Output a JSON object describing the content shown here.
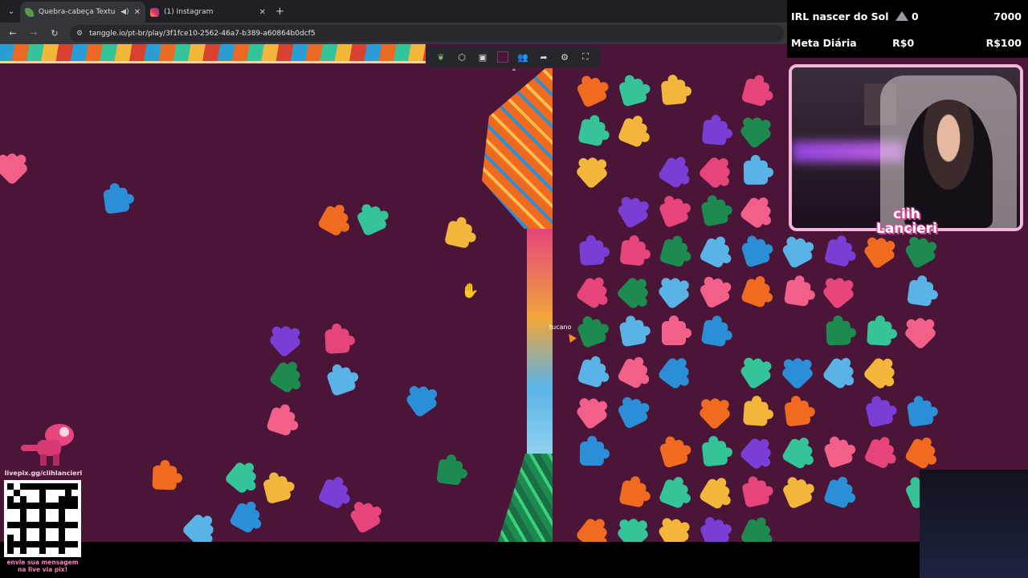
{
  "browser": {
    "tabs": [
      {
        "title": "Quebra-cabeça Texturas",
        "active": true,
        "audio": true
      },
      {
        "title": "(1) Instagram",
        "active": false
      }
    ],
    "url": "tanggle.io/pt-br/play/3f1fce10-2562-46a7-b389-a60864b0dcf5"
  },
  "game": {
    "player_name": "tucano",
    "toolbar_icons": [
      "leaf-icon",
      "puzzle-icon",
      "image-icon",
      "color-swatch",
      "players-icon",
      "share-icon",
      "settings-icon",
      "fullscreen-icon"
    ],
    "background_color": "#4b1537"
  },
  "overlay": {
    "goals": [
      {
        "label": "IRL nascer do Sol",
        "current": "0",
        "target": "7000"
      },
      {
        "label": "Meta Diária",
        "current": "R$0",
        "target": "R$100"
      }
    ],
    "streamer_name_line1": "ciih",
    "streamer_name_line2": "Lancieri",
    "pix_url": "livepix.gg/ciihlancieri",
    "pix_message": "envie sua mensagem na live via pix!"
  }
}
